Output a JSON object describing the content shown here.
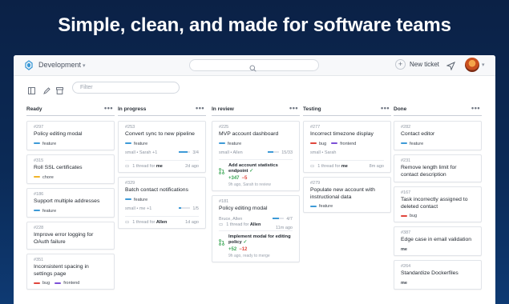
{
  "headline": "Simple, clean, and made for software teams",
  "topbar": {
    "project": "Development",
    "new_ticket": "New ticket",
    "filter_placeholder": "Filter"
  },
  "colors": {
    "feature": "#3d9ad7",
    "chore": "#f0b429",
    "bug": "#e0463c",
    "frontend": "#7c4fd6",
    "added": "#3aa655",
    "removed": "#e0463c"
  },
  "columns": [
    {
      "name": "Ready",
      "cards": [
        {
          "num": "#297",
          "title": "Policy editing modal",
          "tags": [
            {
              "name": "feature",
              "color": "#3d9ad7"
            }
          ]
        },
        {
          "num": "#315",
          "title": "Roll SSL certificates",
          "tags": [
            {
              "name": "chore",
              "color": "#f0b429"
            }
          ]
        },
        {
          "num": "#186",
          "title": "Support multiple addresses",
          "tags": [
            {
              "name": "feature",
              "color": "#3d9ad7"
            }
          ]
        },
        {
          "num": "#228",
          "title": "Improve error logging for OAuth failure",
          "tags": []
        },
        {
          "num": "#351",
          "title": "Inconsistent spacing in settings page",
          "tags": [
            {
              "name": "bug",
              "color": "#e0463c"
            },
            {
              "name": "frontend",
              "color": "#7c4fd6"
            }
          ]
        }
      ]
    },
    {
      "name": "In progress",
      "cards": [
        {
          "num": "#253",
          "title": "Convert sync to new pipeline",
          "tags": [
            {
              "name": "feature",
              "color": "#3d9ad7"
            }
          ],
          "assignees": "small • Sarah +1",
          "progress_text": "3/4",
          "progress": 0.75,
          "thread_text": "1 thread for",
          "thread_user": "me",
          "thread_ago": "2d ago"
        },
        {
          "num": "#329",
          "title": "Batch contact notifications",
          "tags": [
            {
              "name": "feature",
              "color": "#3d9ad7"
            }
          ],
          "assignees": "small • me +1",
          "progress_text": "1/5",
          "progress": 0.2,
          "thread_text": "1 thread for",
          "thread_user": "Allen",
          "thread_ago": "1d ago"
        }
      ]
    },
    {
      "name": "In review",
      "cards": [
        {
          "num": "#225",
          "title": "MVP account dashboard",
          "tags": [
            {
              "name": "feature",
              "color": "#3d9ad7"
            }
          ],
          "assignees": "small • Allen",
          "progress_text": "15/33",
          "progress": 0.45,
          "pr_title": "Add account statistics endpoint",
          "pr_add": "+347",
          "pr_del": "−5",
          "pr_sub": "9h ago, Sarah to review"
        },
        {
          "num": "#181",
          "title": "Policy editing modal",
          "tags": [],
          "assignees": "Bruce, Allen",
          "progress_text": "4/7",
          "progress": 0.57,
          "thread_text": "1 thread for",
          "thread_user": "Allen",
          "thread_ago": "11m ago",
          "pr_title": "Implement modal for editing policy",
          "pr_add": "+52",
          "pr_del": "−12",
          "pr_sub": "9h ago, ready to merge"
        }
      ]
    },
    {
      "name": "Testing",
      "cards": [
        {
          "num": "#277",
          "title": "Incorrect timezone display",
          "tags": [
            {
              "name": "bug",
              "color": "#e0463c"
            },
            {
              "name": "frontend",
              "color": "#7c4fd6"
            }
          ],
          "assignees": "small • Sarah",
          "thread_text": "1 thread for",
          "thread_user": "me",
          "thread_ago": "8m ago"
        },
        {
          "num": "#279",
          "title": "Populate new account with instructional data",
          "tags": [
            {
              "name": "feature",
              "color": "#3d9ad7"
            }
          ]
        }
      ]
    },
    {
      "name": "Done",
      "cards": [
        {
          "num": "#282",
          "title": "Contact editor",
          "tags": [
            {
              "name": "feature",
              "color": "#3d9ad7"
            }
          ]
        },
        {
          "num": "#231",
          "title": "Remove length limit for contact description",
          "tags": []
        },
        {
          "num": "#167",
          "title": "Task incorrectly assigned to deleted contact",
          "tags": [
            {
              "name": "bug",
              "color": "#e0463c"
            }
          ]
        },
        {
          "num": "#387",
          "title": "Edge case in email validation",
          "tags": [],
          "owner": "me"
        },
        {
          "num": "#264",
          "title": "Standardize Dockerfiles",
          "tags": [],
          "owner": "me"
        }
      ]
    }
  ]
}
